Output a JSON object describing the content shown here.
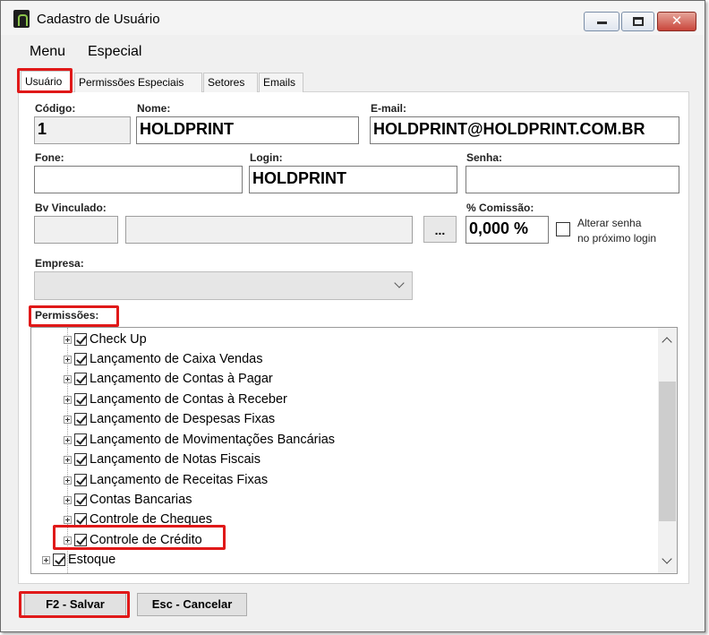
{
  "window": {
    "title": "Cadastro de Usuário",
    "close_glyph": "✕"
  },
  "menu": [
    "Menu",
    "Especial"
  ],
  "tabs": [
    "Usuário",
    "Permissões Especiais",
    "Setores",
    "Emails"
  ],
  "form": {
    "codigo": {
      "label": "Código:",
      "value": "1"
    },
    "nome": {
      "label": "Nome:",
      "value": "HOLDPRINT"
    },
    "email": {
      "label": "E-mail:",
      "value": "HOLDPRINT@HOLDPRINT.COM.BR"
    },
    "fone": {
      "label": "Fone:",
      "value": ""
    },
    "login": {
      "label": "Login:",
      "value": "HOLDPRINT"
    },
    "senha": {
      "label": "Senha:",
      "value": ""
    },
    "bv": {
      "label": "Bv Vinculado:",
      "code": "",
      "name": "",
      "button": "..."
    },
    "comissao": {
      "label": "% Comissão:",
      "value": "0,000 %"
    },
    "alterar_senha": {
      "line1": "Alterar senha",
      "line2": "no próximo login",
      "checked": false
    },
    "empresa": {
      "label": "Empresa:",
      "value": ""
    },
    "permissoes_label": "Permissões:"
  },
  "tree": [
    {
      "label": "Check Up",
      "checked": true
    },
    {
      "label": "Lançamento de Caixa Vendas",
      "checked": true
    },
    {
      "label": "Lançamento de Contas à Pagar",
      "checked": true
    },
    {
      "label": "Lançamento de Contas à Receber",
      "checked": true
    },
    {
      "label": "Lançamento de Despesas Fixas",
      "checked": true
    },
    {
      "label": "Lançamento de Movimentações Bancárias",
      "checked": true
    },
    {
      "label": "Lançamento de Notas Fiscais",
      "checked": true
    },
    {
      "label": "Lançamento de Receitas Fixas",
      "checked": true
    },
    {
      "label": "Contas Bancarias",
      "checked": true
    },
    {
      "label": "Controle de Cheques",
      "checked": true
    },
    {
      "label": "Controle de Crédito",
      "checked": true
    },
    {
      "label": "Estoque",
      "checked": true
    }
  ],
  "buttons": {
    "save": "F2 - Salvar",
    "cancel": "Esc - Cancelar"
  },
  "colors": {
    "highlight": "#e01919",
    "window_bg": "#f0f0f0",
    "close_button": "#c9453a"
  }
}
